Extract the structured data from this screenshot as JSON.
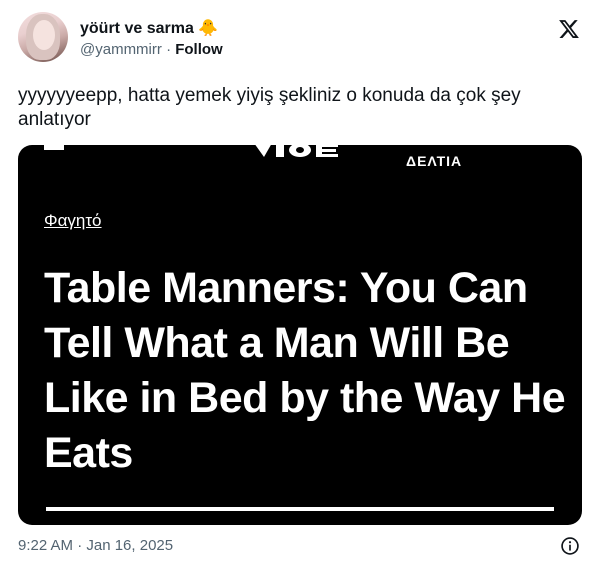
{
  "tweet": {
    "author_name": "yöürt ve sarma",
    "emoji": "🐥",
    "handle": "@yammmirr",
    "separator": "·",
    "follow_label": "Follow",
    "text": "yyyyyyeepp, hatta yemek yiyiş şekliniz o konuda da çok şey anlatıyor",
    "timestamp": "9:22 AM · Jan 16, 2025"
  },
  "card": {
    "section": "ΔΕΛΤΙΑ",
    "category": "Φαγητό",
    "headline": "Table Manners: You Can Tell What a Man Will Be Like in Bed by the Way He Eats"
  },
  "icons": {
    "platform": "x-logo-icon",
    "info": "info-icon",
    "menu": "hamburger-menu-icon",
    "brand": "vice-logo-icon"
  },
  "colors": {
    "text": "#0f1419",
    "muted": "#536471",
    "card_bg": "#000000",
    "card_text": "#ffffff"
  }
}
